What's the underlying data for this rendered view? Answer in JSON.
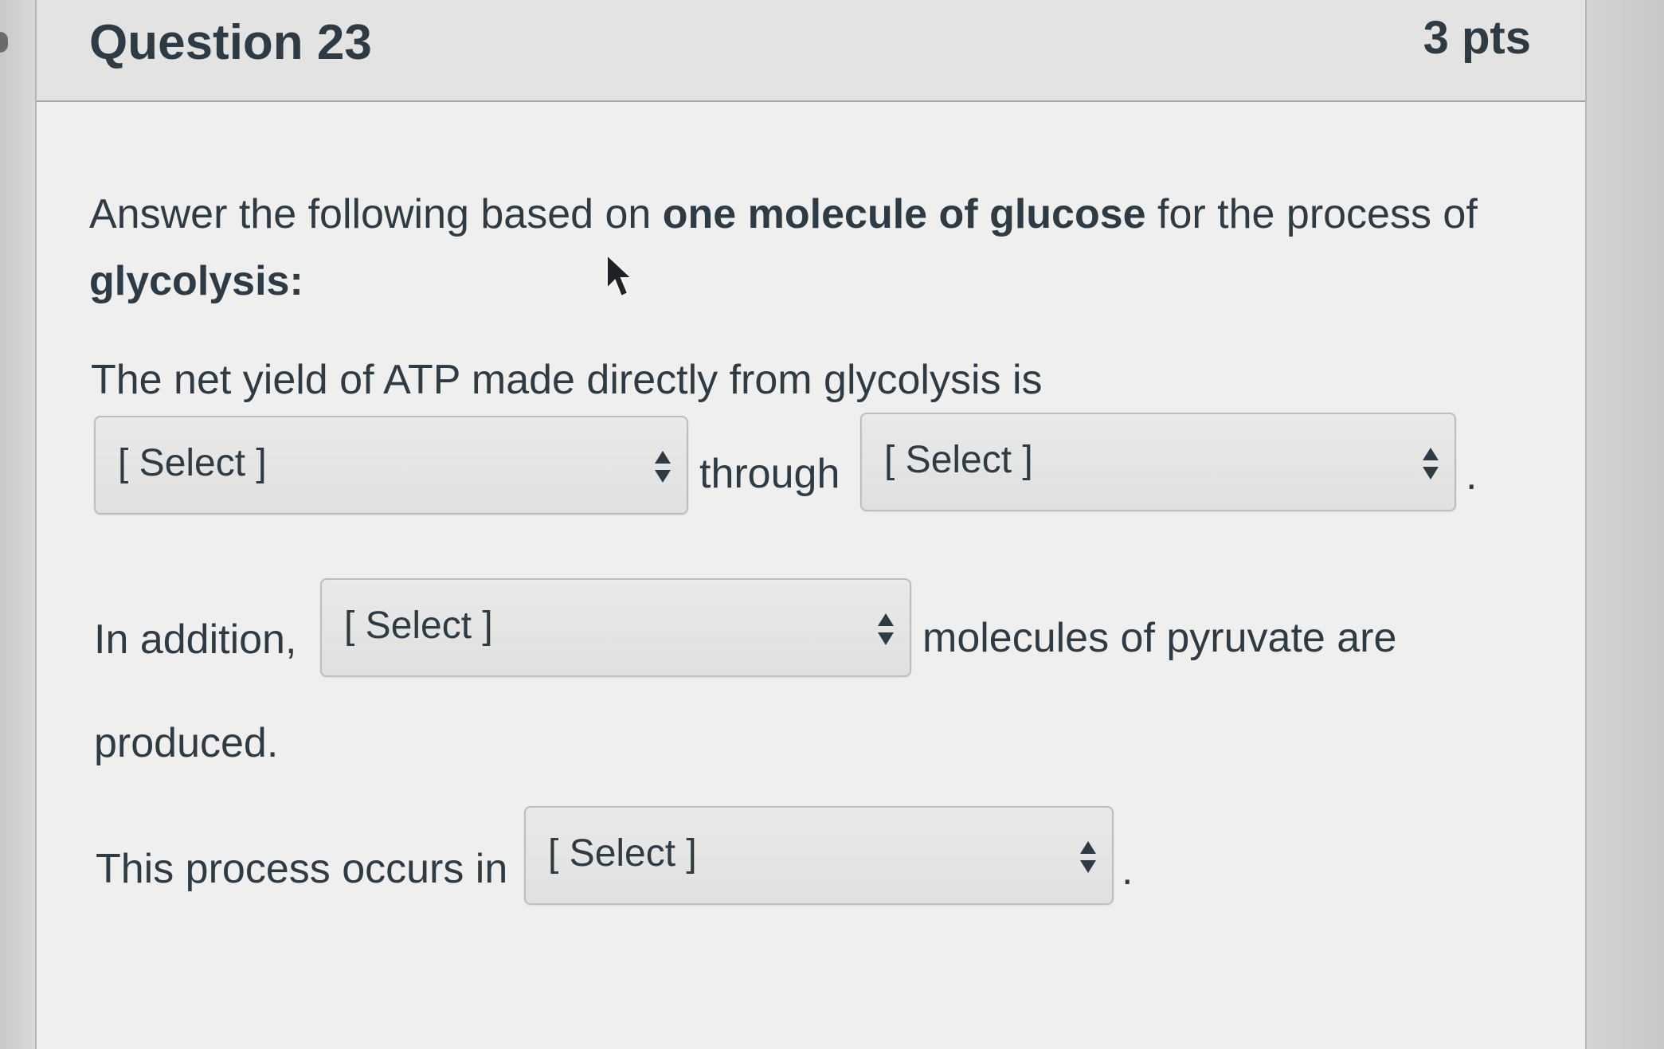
{
  "question": {
    "title": "Question 23",
    "points": "3 pts"
  },
  "prompt": {
    "part1": "Answer the following based on",
    "bold": "one molecule of glucose",
    "part2": "for the process of",
    "line2": "glycolysis:"
  },
  "sentence1": {
    "text": "The net yield of ATP made directly from glycolysis is",
    "connector": "through",
    "end": "."
  },
  "sentence2": {
    "lead": "In addition,",
    "tail": "molecules of pyruvate are",
    "wrap": "produced."
  },
  "sentence3": {
    "lead": "This process occurs in",
    "end": "."
  },
  "dropdowns": {
    "atp_yield": "[ Select ]",
    "atp_mechanism": "[ Select ]",
    "pyruvate_count": "[ Select ]",
    "location": "[ Select ]"
  },
  "icons": {
    "dropdown": "up-down-arrows-icon",
    "cursor": "mouse-pointer-icon"
  },
  "colors": {
    "text": "#2d3b45",
    "card_background": "#efefed",
    "header_background": "#e3e4e2"
  }
}
